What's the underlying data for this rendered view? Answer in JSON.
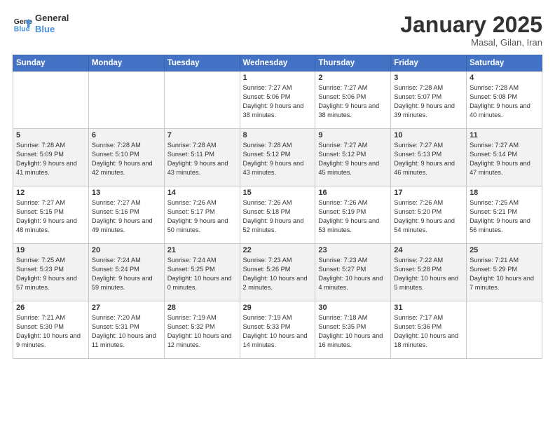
{
  "header": {
    "logo_line1": "General",
    "logo_line2": "Blue",
    "title": "January 2025",
    "subtitle": "Masal, Gilan, Iran"
  },
  "weekdays": [
    "Sunday",
    "Monday",
    "Tuesday",
    "Wednesday",
    "Thursday",
    "Friday",
    "Saturday"
  ],
  "weeks": [
    [
      {
        "day": "",
        "info": ""
      },
      {
        "day": "",
        "info": ""
      },
      {
        "day": "",
        "info": ""
      },
      {
        "day": "1",
        "info": "Sunrise: 7:27 AM\nSunset: 5:06 PM\nDaylight: 9 hours\nand 38 minutes."
      },
      {
        "day": "2",
        "info": "Sunrise: 7:27 AM\nSunset: 5:06 PM\nDaylight: 9 hours\nand 38 minutes."
      },
      {
        "day": "3",
        "info": "Sunrise: 7:28 AM\nSunset: 5:07 PM\nDaylight: 9 hours\nand 39 minutes."
      },
      {
        "day": "4",
        "info": "Sunrise: 7:28 AM\nSunset: 5:08 PM\nDaylight: 9 hours\nand 40 minutes."
      }
    ],
    [
      {
        "day": "5",
        "info": "Sunrise: 7:28 AM\nSunset: 5:09 PM\nDaylight: 9 hours\nand 41 minutes."
      },
      {
        "day": "6",
        "info": "Sunrise: 7:28 AM\nSunset: 5:10 PM\nDaylight: 9 hours\nand 42 minutes."
      },
      {
        "day": "7",
        "info": "Sunrise: 7:28 AM\nSunset: 5:11 PM\nDaylight: 9 hours\nand 43 minutes."
      },
      {
        "day": "8",
        "info": "Sunrise: 7:28 AM\nSunset: 5:12 PM\nDaylight: 9 hours\nand 43 minutes."
      },
      {
        "day": "9",
        "info": "Sunrise: 7:27 AM\nSunset: 5:12 PM\nDaylight: 9 hours\nand 45 minutes."
      },
      {
        "day": "10",
        "info": "Sunrise: 7:27 AM\nSunset: 5:13 PM\nDaylight: 9 hours\nand 46 minutes."
      },
      {
        "day": "11",
        "info": "Sunrise: 7:27 AM\nSunset: 5:14 PM\nDaylight: 9 hours\nand 47 minutes."
      }
    ],
    [
      {
        "day": "12",
        "info": "Sunrise: 7:27 AM\nSunset: 5:15 PM\nDaylight: 9 hours\nand 48 minutes."
      },
      {
        "day": "13",
        "info": "Sunrise: 7:27 AM\nSunset: 5:16 PM\nDaylight: 9 hours\nand 49 minutes."
      },
      {
        "day": "14",
        "info": "Sunrise: 7:26 AM\nSunset: 5:17 PM\nDaylight: 9 hours\nand 50 minutes."
      },
      {
        "day": "15",
        "info": "Sunrise: 7:26 AM\nSunset: 5:18 PM\nDaylight: 9 hours\nand 52 minutes."
      },
      {
        "day": "16",
        "info": "Sunrise: 7:26 AM\nSunset: 5:19 PM\nDaylight: 9 hours\nand 53 minutes."
      },
      {
        "day": "17",
        "info": "Sunrise: 7:26 AM\nSunset: 5:20 PM\nDaylight: 9 hours\nand 54 minutes."
      },
      {
        "day": "18",
        "info": "Sunrise: 7:25 AM\nSunset: 5:21 PM\nDaylight: 9 hours\nand 56 minutes."
      }
    ],
    [
      {
        "day": "19",
        "info": "Sunrise: 7:25 AM\nSunset: 5:23 PM\nDaylight: 9 hours\nand 57 minutes."
      },
      {
        "day": "20",
        "info": "Sunrise: 7:24 AM\nSunset: 5:24 PM\nDaylight: 9 hours\nand 59 minutes."
      },
      {
        "day": "21",
        "info": "Sunrise: 7:24 AM\nSunset: 5:25 PM\nDaylight: 10 hours\nand 0 minutes."
      },
      {
        "day": "22",
        "info": "Sunrise: 7:23 AM\nSunset: 5:26 PM\nDaylight: 10 hours\nand 2 minutes."
      },
      {
        "day": "23",
        "info": "Sunrise: 7:23 AM\nSunset: 5:27 PM\nDaylight: 10 hours\nand 4 minutes."
      },
      {
        "day": "24",
        "info": "Sunrise: 7:22 AM\nSunset: 5:28 PM\nDaylight: 10 hours\nand 5 minutes."
      },
      {
        "day": "25",
        "info": "Sunrise: 7:21 AM\nSunset: 5:29 PM\nDaylight: 10 hours\nand 7 minutes."
      }
    ],
    [
      {
        "day": "26",
        "info": "Sunrise: 7:21 AM\nSunset: 5:30 PM\nDaylight: 10 hours\nand 9 minutes."
      },
      {
        "day": "27",
        "info": "Sunrise: 7:20 AM\nSunset: 5:31 PM\nDaylight: 10 hours\nand 11 minutes."
      },
      {
        "day": "28",
        "info": "Sunrise: 7:19 AM\nSunset: 5:32 PM\nDaylight: 10 hours\nand 12 minutes."
      },
      {
        "day": "29",
        "info": "Sunrise: 7:19 AM\nSunset: 5:33 PM\nDaylight: 10 hours\nand 14 minutes."
      },
      {
        "day": "30",
        "info": "Sunrise: 7:18 AM\nSunset: 5:35 PM\nDaylight: 10 hours\nand 16 minutes."
      },
      {
        "day": "31",
        "info": "Sunrise: 7:17 AM\nSunset: 5:36 PM\nDaylight: 10 hours\nand 18 minutes."
      },
      {
        "day": "",
        "info": ""
      }
    ]
  ]
}
